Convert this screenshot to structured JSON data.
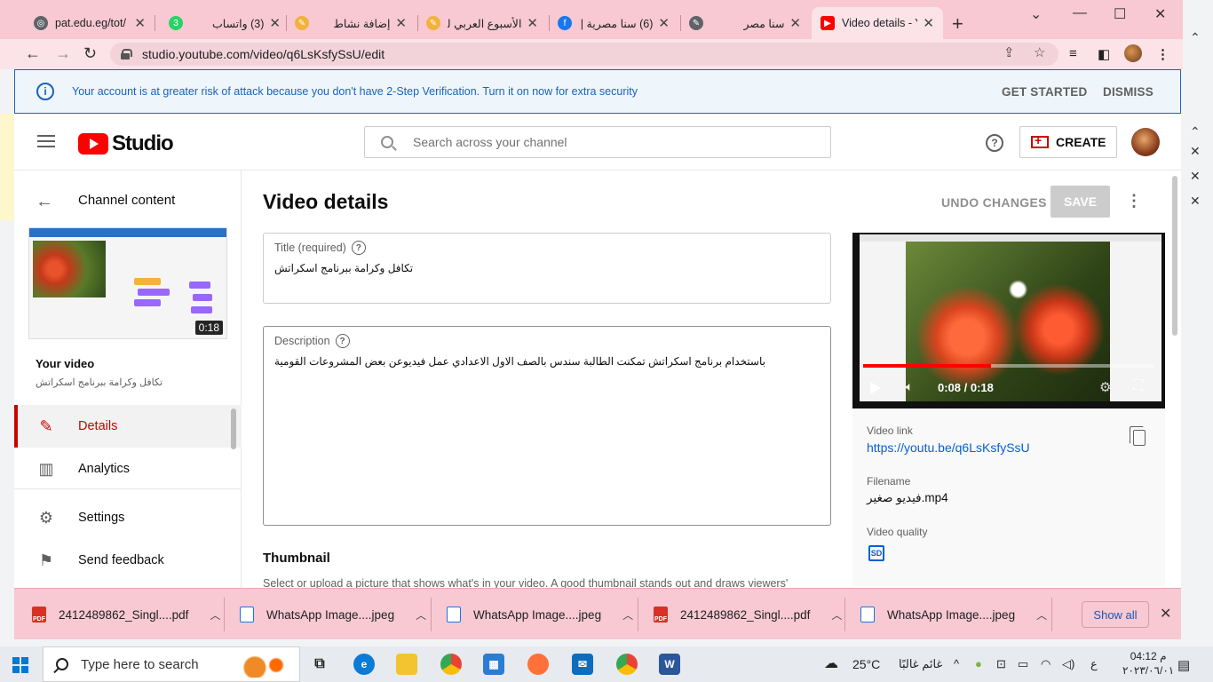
{
  "browser": {
    "tabs": [
      {
        "title": "pat.edu.eg/tot/",
        "icon": "globe-icon",
        "color": "#5f6368"
      },
      {
        "title": "(3) واتساب",
        "icon": "whatsapp-icon",
        "color": "#25d366"
      },
      {
        "title": "إضافة نشاط",
        "icon": "pencil-icon",
        "color": "#f2b23c"
      },
      {
        "title": "الأسبوع العربي لـ",
        "icon": "pencil-icon",
        "color": "#f2b23c"
      },
      {
        "title": "(6) سنا مصرية |",
        "icon": "facebook-icon",
        "color": "#1877f2"
      },
      {
        "title": "سنا مصر",
        "icon": "edit-icon",
        "color": "#5f6368"
      },
      {
        "title": "Video details - Y",
        "icon": "youtube-icon",
        "color": "#ff0000"
      }
    ],
    "address": "studio.youtube.com/video/q6LsKsfySsU/edit"
  },
  "banner": {
    "message": "Your account is at greater risk of attack because you don't have 2-Step Verification. Turn it on now for extra security",
    "get_started": "GET STARTED",
    "dismiss": "DISMISS"
  },
  "header": {
    "logo_text": "Studio",
    "search_placeholder": "Search across your channel",
    "create_label": "CREATE"
  },
  "sidebar": {
    "back_label": "Channel content",
    "thumbnail_duration": "0:18",
    "your_video_label": "Your video",
    "video_title": "تكافل وكرامة ببرنامج اسكراتش",
    "items": [
      {
        "label": "Details",
        "icon": "pencil-icon",
        "active": true
      },
      {
        "label": "Analytics",
        "icon": "analytics-icon",
        "active": false
      },
      {
        "label": "Settings",
        "icon": "gear-icon",
        "active": false
      },
      {
        "label": "Send feedback",
        "icon": "feedback-icon",
        "active": false
      }
    ]
  },
  "main": {
    "page_title": "Video details",
    "undo_label": "UNDO CHANGES",
    "save_label": "SAVE",
    "title_label": "Title (required)",
    "title_value": "تكافل وكرامة ببرنامج اسكراتش",
    "description_label": "Description",
    "description_value": "باستخدام برنامج اسكراتش تمكنت الطالبة سندس بالصف الاول الاعدادي عمل فيديوعن بعض المشروعات القومية",
    "thumbnail_heading": "Thumbnail",
    "thumbnail_desc": "Select or upload a picture that shows what's in your video. A good thumbnail stands out and draws viewers'"
  },
  "preview": {
    "time": "0:08 / 0:18",
    "progress": 0.44,
    "video_link_label": "Video link",
    "video_link": "https://youtu.be/q6LsKsfySsU",
    "filename_label": "Filename",
    "filename": "فيديو صغير.mp4",
    "quality_label": "Video quality",
    "quality_badge": "SD"
  },
  "downloads": {
    "files": [
      {
        "name": "2412489862_Singl....pdf",
        "type": "pdf"
      },
      {
        "name": "WhatsApp Image....jpeg",
        "type": "img"
      },
      {
        "name": "WhatsApp Image....jpeg",
        "type": "img"
      },
      {
        "name": "2412489862_Singl....pdf",
        "type": "pdf"
      },
      {
        "name": "WhatsApp Image....jpeg",
        "type": "img"
      }
    ],
    "show_all": "Show all"
  },
  "taskbar": {
    "search_placeholder": "Type here to search",
    "weather": "25°C",
    "weather_desc": "غائم غالبًا",
    "lang": "ع",
    "time": "04:12 م",
    "date": "٢٠٢٣/٠٦/٠١"
  },
  "colors": {
    "accent": "#cc0000",
    "link": "#065fd4",
    "banner": "#1c62b9",
    "browser_chrome": "#f8c9d2"
  }
}
